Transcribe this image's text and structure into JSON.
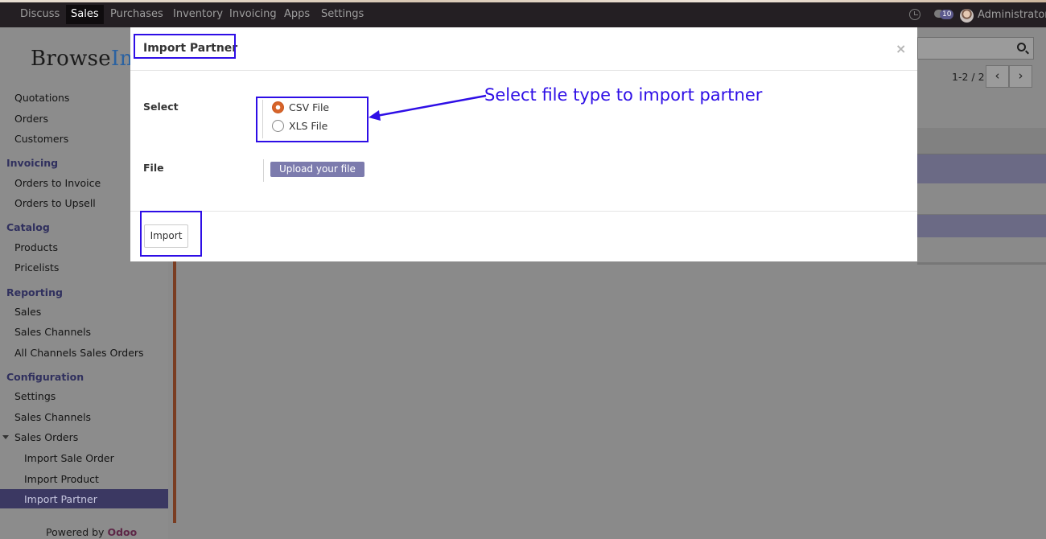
{
  "navbar": {
    "items": [
      "Discuss",
      "Sales",
      "Purchases",
      "Inventory",
      "Invoicing",
      "Apps",
      "Settings"
    ],
    "active": "Sales",
    "notification_count": "10",
    "user": "Administrator"
  },
  "logo": {
    "part1": "Browse",
    "part2": "Inf"
  },
  "sidebar": {
    "quotations": "Quotations",
    "orders": "Orders",
    "customers": "Customers",
    "invoicing_header": "Invoicing",
    "orders_to_invoice": "Orders to Invoice",
    "orders_to_upsell": "Orders to Upsell",
    "catalog_header": "Catalog",
    "products": "Products",
    "pricelists": "Pricelists",
    "reporting_header": "Reporting",
    "sales": "Sales",
    "sales_channels": "Sales Channels",
    "all_channels": "All Channels Sales Orders",
    "configuration_header": "Configuration",
    "settings": "Settings",
    "config_sales_channels": "Sales Channels",
    "sales_orders": "Sales Orders",
    "import_sale_order": "Import Sale Order",
    "import_product": "Import Product",
    "import_partner": "Import Partner"
  },
  "powered": {
    "prefix": "Powered by",
    "brand": "Odoo"
  },
  "pager": {
    "text": "1-2 / 2"
  },
  "modal": {
    "title": "Import Partner",
    "close": "×",
    "select_label": "Select",
    "options": [
      "CSV File",
      "XLS File"
    ],
    "selected_option": "CSV File",
    "file_label": "File",
    "upload_label": "Upload your file",
    "import_label": "Import"
  },
  "annotation": {
    "text": "Select file type to import partner"
  },
  "colors": {
    "annotation": "#2e0ee6",
    "upload_button": "#7c7bad",
    "radio_checked": "#d7642a",
    "active_menu": "#3b3862"
  }
}
